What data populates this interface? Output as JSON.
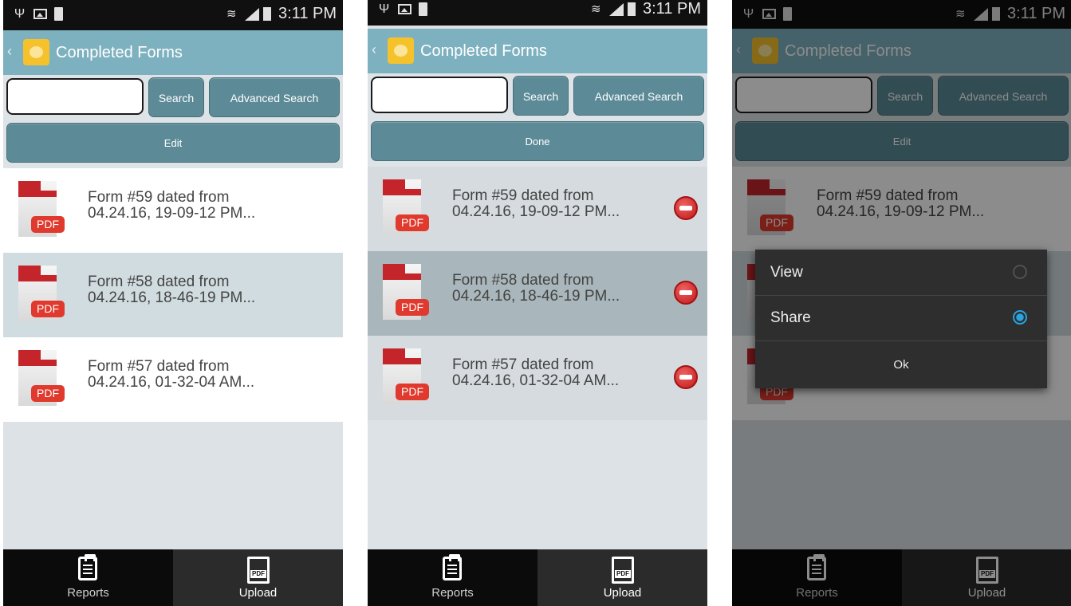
{
  "status_bar": {
    "time": "3:11 PM"
  },
  "app": {
    "title": "Completed Forms",
    "back_icon": "‹"
  },
  "toolbar": {
    "search_label": "Search",
    "advanced_search_label": "Advanced Search"
  },
  "screens": [
    {
      "action_label": "Edit",
      "delete_mode": false
    },
    {
      "action_label": "Done",
      "delete_mode": true
    },
    {
      "action_label": "Edit",
      "delete_mode": false
    }
  ],
  "forms": [
    {
      "line1": "Form #59 dated from",
      "line2": "04.24.16, 19-09-12 PM...",
      "icon_label": "PDF"
    },
    {
      "line1": "Form #58 dated from",
      "line2": "04.24.16, 18-46-19 PM...",
      "icon_label": "PDF"
    },
    {
      "line1": "Form #57 dated from",
      "line2": "04.24.16, 01-32-04 AM...",
      "icon_label": "PDF"
    }
  ],
  "tabs": {
    "reports": "Reports",
    "upload": "Upload",
    "upload_icon_label": "PDF"
  },
  "dialog": {
    "options": [
      {
        "label": "View",
        "selected": false
      },
      {
        "label": "Share",
        "selected": true
      }
    ],
    "ok_label": "Ok"
  },
  "colors": {
    "app_bar": "#7eb1bf",
    "button": "#5c8b97",
    "pdf_red": "#c4252b",
    "delete_red": "#d52222",
    "radio_selected": "#2aa3e0"
  }
}
